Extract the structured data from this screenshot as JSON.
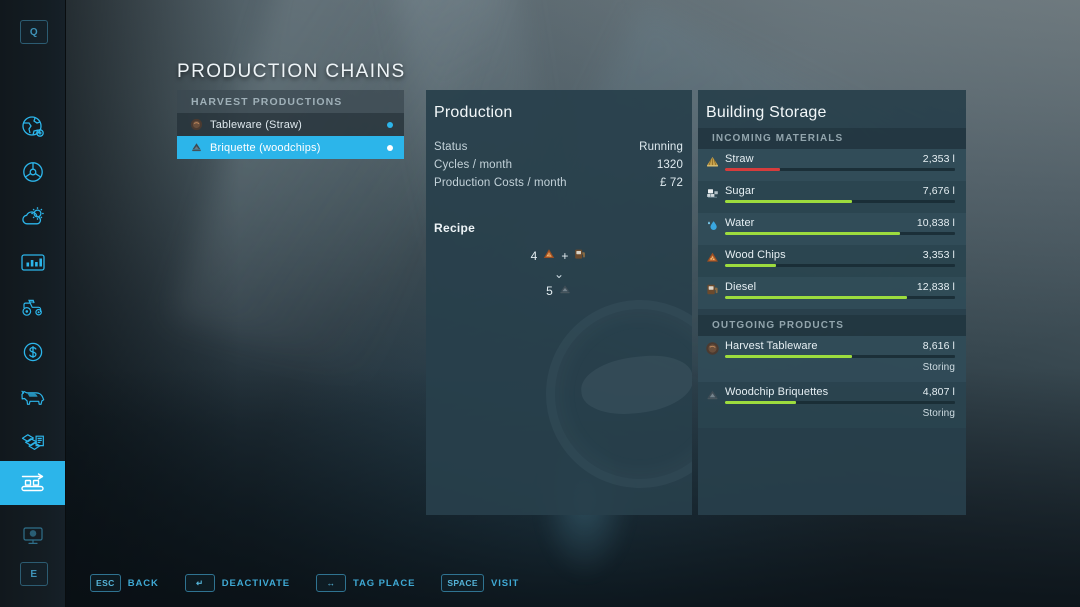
{
  "page": {
    "title": "PRODUCTION CHAINS"
  },
  "sidebar": {
    "top_key": "Q",
    "bottom_key": "E",
    "items": [
      {
        "name": "globe-map-icon",
        "label": "Map"
      },
      {
        "name": "steering-wheel-icon",
        "label": "Vehicles"
      },
      {
        "name": "weather-icon",
        "label": "Weather"
      },
      {
        "name": "statistics-icon",
        "label": "Statistics"
      },
      {
        "name": "tractor-icon",
        "label": "Vehicle Overview"
      },
      {
        "name": "finances-icon",
        "label": "Finances"
      },
      {
        "name": "animals-icon",
        "label": "Animals"
      },
      {
        "name": "contracts-icon",
        "label": "Contracts"
      },
      {
        "name": "production-chains-icon",
        "label": "Production Chains"
      },
      {
        "name": "ai-workers-icon",
        "label": "Helpers"
      }
    ],
    "active_index": 8
  },
  "production_list": {
    "header": "HARVEST PRODUCTIONS",
    "items": [
      {
        "label": "Tableware (Straw)",
        "icon": "tableware-icon",
        "selected": false
      },
      {
        "label": "Briquette (woodchips)",
        "icon": "briquette-icon",
        "selected": true
      }
    ]
  },
  "production": {
    "title": "Production",
    "stats": [
      {
        "key": "Status",
        "value": "Running"
      },
      {
        "key": "Cycles / month",
        "value": "1320"
      },
      {
        "key": "Production Costs / month",
        "value": "£ 72"
      }
    ],
    "recipe_title": "Recipe",
    "recipe": {
      "inputs": [
        {
          "amount": "4",
          "icon": "wood-chips-icon"
        },
        {
          "amount": "",
          "icon": "diesel-icon"
        }
      ],
      "plus": "+",
      "arrow": "⌄",
      "outputs": [
        {
          "amount": "5",
          "icon": "briquette-icon"
        }
      ]
    }
  },
  "building_storage": {
    "title": "Building Storage",
    "incoming_header": "INCOMING MATERIALS",
    "outgoing_header": "OUTGOING PRODUCTS",
    "incoming": [
      {
        "name": "Straw",
        "amount": "2,353 l",
        "fill": 24,
        "color": "#d63c3c",
        "icon": "straw-icon"
      },
      {
        "name": "Sugar",
        "amount": "7,676 l",
        "fill": 55,
        "color": "#9ddc3e",
        "icon": "sugar-icon"
      },
      {
        "name": "Water",
        "amount": "10,838 l",
        "fill": 76,
        "color": "#9ddc3e",
        "icon": "water-icon"
      },
      {
        "name": "Wood Chips",
        "amount": "3,353 l",
        "fill": 22,
        "color": "#9ddc3e",
        "icon": "wood-chips-icon"
      },
      {
        "name": "Diesel",
        "amount": "12,838 l",
        "fill": 79,
        "color": "#9ddc3e",
        "icon": "diesel-icon"
      }
    ],
    "outgoing": [
      {
        "name": "Harvest Tableware",
        "amount": "8,616 l",
        "fill": 55,
        "color": "#9ddc3e",
        "state": "Storing",
        "icon": "tableware-icon"
      },
      {
        "name": "Woodchip Briquettes",
        "amount": "4,807 l",
        "fill": 31,
        "color": "#9ddc3e",
        "state": "Storing",
        "icon": "briquette-icon"
      }
    ]
  },
  "helpbar": {
    "items": [
      {
        "key": "ESC",
        "label": "BACK"
      },
      {
        "key": "↵",
        "label": "DEACTIVATE"
      },
      {
        "key": "↔",
        "label": "TAG PLACE"
      },
      {
        "key": "SPACE",
        "label": "VISIT"
      }
    ]
  },
  "colors": {
    "accent": "#2cb5ea",
    "panel": "#28404b",
    "bar_green": "#9ddc3e",
    "bar_red": "#d63c3c"
  }
}
